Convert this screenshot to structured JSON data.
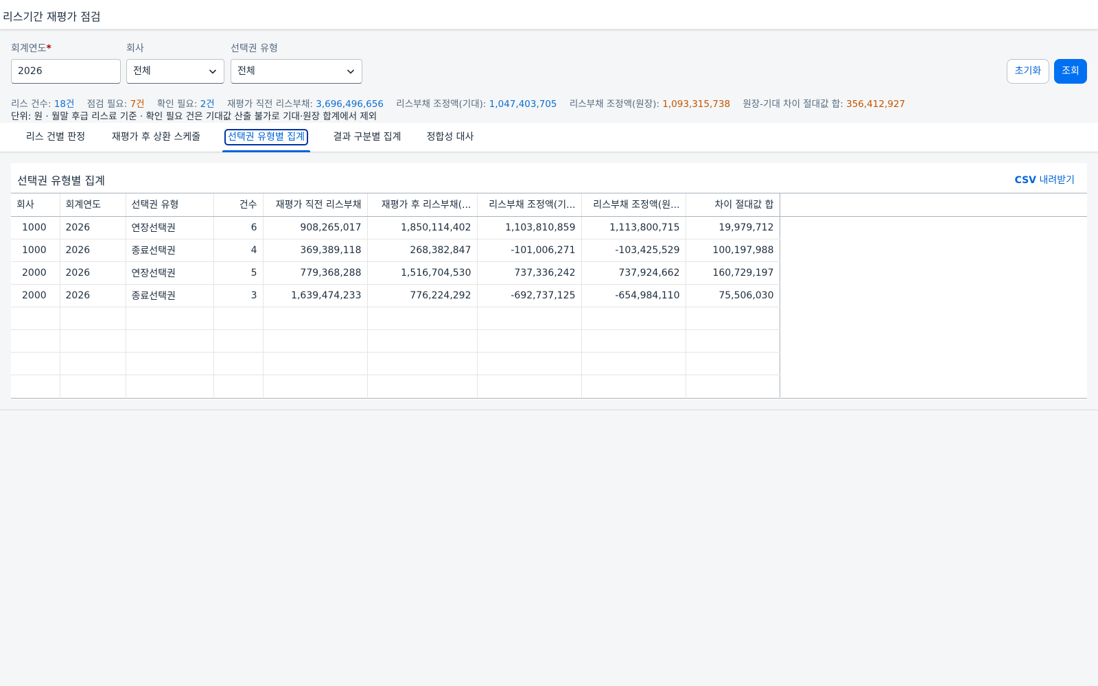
{
  "app": {
    "title": "리스기간 재평가 점검"
  },
  "filters": {
    "year": {
      "label": "회계연도",
      "required_mark": "*",
      "value": "2026"
    },
    "company": {
      "label": "회사",
      "value": "전체"
    },
    "option_type": {
      "label": "선택권 유형",
      "value": "전체"
    }
  },
  "buttons": {
    "reset": "초기화",
    "search": "조회"
  },
  "stats": {
    "lease_count_label": "리스 건수:",
    "lease_count": "18건",
    "check_needed_label": "점검 필요:",
    "check_needed": "7건",
    "confirm_needed_label": "확인 필요:",
    "confirm_needed": "2건",
    "pre_liability_label": "재평가 직전 리스부채:",
    "pre_liability": "3,696,496,656",
    "adj_expected_label": "리스부채 조정액(기대):",
    "adj_expected": "1,047,403,705",
    "adj_ledger_label": "리스부채 조정액(원장):",
    "adj_ledger": "1,093,315,738",
    "diff_label": "원장-기대 차이 절대값 합:",
    "diff": "356,412,927"
  },
  "unit_note": "단위: 원 · 월말 후급 리스료 기준 · 확인 필요 건은 기대값 산출 불가로 기대·원장 합계에서 제외",
  "tabs": [
    {
      "label": "리스 건별 판정"
    },
    {
      "label": "재평가 후 상환 스케줄"
    },
    {
      "label": "선택권 유형별 집계"
    },
    {
      "label": "결과 구분별 집계"
    },
    {
      "label": "정합성 대사"
    }
  ],
  "panel": {
    "title": "선택권 유형별 집계",
    "csv_prefix": "CSV",
    "csv_suffix": " 내려받기"
  },
  "table": {
    "columns": [
      "회사",
      "회계연도",
      "선택권 유형",
      "건수",
      "재평가 직전 리스부채",
      "재평가 후 리스부채(...",
      "리스부채 조정액(기...",
      "리스부채 조정액(원...",
      "차이 절대값 합"
    ],
    "rows": [
      [
        "1000",
        "2026",
        "연장선택권",
        "6",
        "908,265,017",
        "1,850,114,402",
        "1,103,810,859",
        "1,113,800,715",
        "19,979,712"
      ],
      [
        "1000",
        "2026",
        "종료선택권",
        "4",
        "369,389,118",
        "268,382,847",
        "-101,006,271",
        "-103,425,529",
        "100,197,988"
      ],
      [
        "2000",
        "2026",
        "연장선택권",
        "5",
        "779,368,288",
        "1,516,704,530",
        "737,336,242",
        "737,924,662",
        "160,729,197"
      ],
      [
        "2000",
        "2026",
        "종료선택권",
        "3",
        "1,639,474,233",
        "776,224,292",
        "-692,737,125",
        "-654,984,110",
        "75,506,030"
      ]
    ]
  },
  "colors": {
    "accent": "#0070f2",
    "link": "#0064d9",
    "stat_blue": "#0a6ed1",
    "stat_orange": "#c35500"
  }
}
